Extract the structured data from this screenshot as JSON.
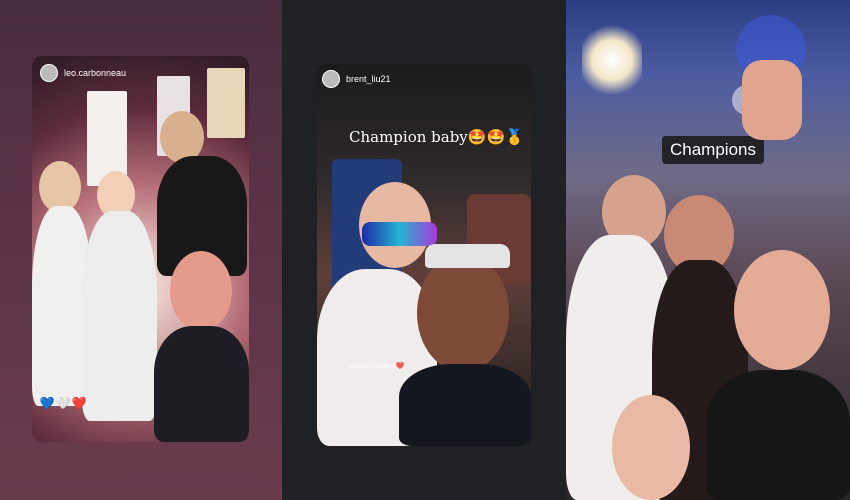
{
  "panels": [
    {
      "username": "leo.carbonneau",
      "hearts": [
        "💙",
        "🤍",
        "❤️"
      ]
    },
    {
      "username": "brent_liu21",
      "caption": "Champion baby🤩🤩🥇",
      "tag_text": "yanickjunqueira❤️"
    },
    {
      "overlay_text": "Champions"
    }
  ],
  "colors": {
    "panel1_bg": "#5b3347",
    "panel2_bg": "#1f2124",
    "accent_blue": "#1f3fb9"
  }
}
